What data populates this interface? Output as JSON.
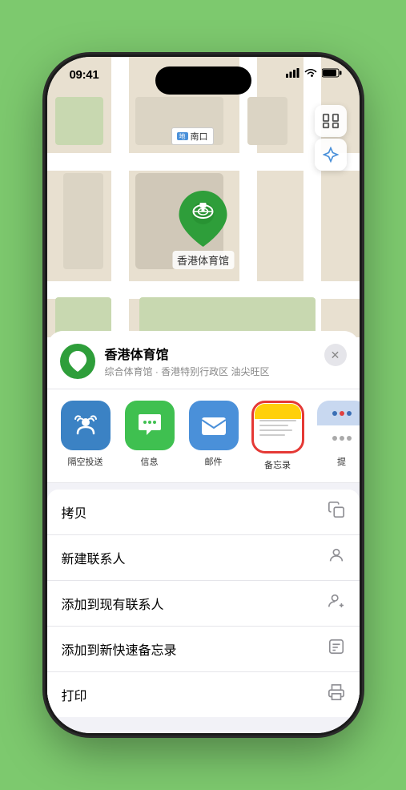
{
  "statusBar": {
    "time": "09:41",
    "locationIcon": "▶"
  },
  "mapLabel": {
    "prefix": "南口"
  },
  "marker": {
    "label": "香港体育馆"
  },
  "locationCard": {
    "name": "香港体育馆",
    "subtitle": "综合体育馆 · 香港特别行政区 油尖旺区",
    "closeLabel": "✕"
  },
  "shareItems": [
    {
      "id": "airdrop",
      "label": "隔空投送"
    },
    {
      "id": "messages",
      "label": "信息"
    },
    {
      "id": "mail",
      "label": "邮件"
    },
    {
      "id": "notes",
      "label": "备忘录",
      "selected": true
    },
    {
      "id": "more",
      "label": "提"
    }
  ],
  "actions": [
    {
      "label": "拷贝",
      "icon": "📋"
    },
    {
      "label": "新建联系人",
      "icon": "👤"
    },
    {
      "label": "添加到现有联系人",
      "icon": "👤"
    },
    {
      "label": "添加到新快速备忘录",
      "icon": "📝"
    },
    {
      "label": "打印",
      "icon": "🖨️"
    }
  ]
}
